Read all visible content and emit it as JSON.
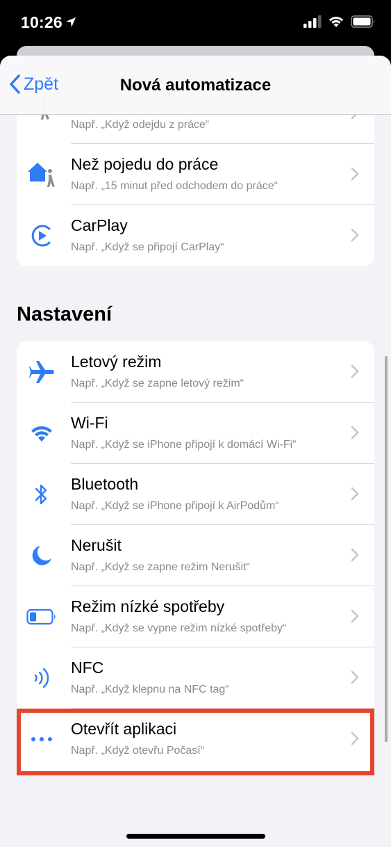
{
  "status_bar": {
    "time": "10:26"
  },
  "nav": {
    "back_label": "Zpět",
    "title": "Nová automatizace"
  },
  "top_rows": [
    {
      "title": "",
      "subtitle": "Např. „Když odejdu z práce“",
      "icon": "home-leave-person-icon"
    },
    {
      "title": "Než pojedu do práce",
      "subtitle": "Např. „15 minut před odchodem do práce“",
      "icon": "home-person-icon"
    },
    {
      "title": "CarPlay",
      "subtitle": "Např. „Když se připojí CarPlay“",
      "icon": "carplay-icon"
    }
  ],
  "settings_section": {
    "header": "Nastavení",
    "rows": [
      {
        "title": "Letový režim",
        "subtitle": "Např. „Když se zapne letový režim“",
        "icon": "airplane-icon"
      },
      {
        "title": "Wi-Fi",
        "subtitle": "Např. „Když se iPhone připojí k domácí Wi-Fi“",
        "icon": "wifi-icon"
      },
      {
        "title": "Bluetooth",
        "subtitle": "Např. „Když se iPhone připojí k AirPodům“",
        "icon": "bluetooth-icon"
      },
      {
        "title": "Nerušit",
        "subtitle": "Např. „Když se zapne režim Nerušit“",
        "icon": "moon-icon"
      },
      {
        "title": "Režim nízké spotřeby",
        "subtitle": "Např. „Když se vypne režim nízké spotřeby“",
        "icon": "low-battery-icon"
      },
      {
        "title": "NFC",
        "subtitle": "Např. „Když klepnu na NFC tag“",
        "icon": "nfc-icon"
      },
      {
        "title": "Otevřít aplikaci",
        "subtitle": "Např. „Když otevřu Počasí“",
        "icon": "ellipsis-icon"
      }
    ]
  },
  "colors": {
    "accent": "#2f7cf6",
    "highlight": "#e5452c",
    "background": "#f2f2f7"
  }
}
